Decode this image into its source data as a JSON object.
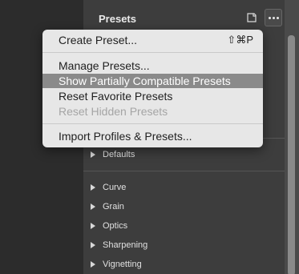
{
  "panel": {
    "title": "Presets"
  },
  "icons": {
    "new_preset": "new-preset-icon",
    "more": "more-options-icon"
  },
  "menu": {
    "items": [
      {
        "label": "Create Preset...",
        "shortcut": "⇧⌘P",
        "enabled": true
      },
      {
        "label": "Manage Presets...",
        "enabled": true
      },
      {
        "label": "Show Partially Compatible Presets",
        "enabled": true,
        "highlighted": true
      },
      {
        "label": "Reset Favorite Presets",
        "enabled": true
      },
      {
        "label": "Reset Hidden Presets",
        "enabled": false
      },
      {
        "label": "Import Profiles & Presets...",
        "enabled": true
      }
    ]
  },
  "groups": [
    {
      "label": "Defaults"
    },
    {
      "label": "Curve"
    },
    {
      "label": "Grain"
    },
    {
      "label": "Optics"
    },
    {
      "label": "Sharpening"
    },
    {
      "label": "Vignetting"
    }
  ],
  "colors": {
    "panel_bg": "#3d3d3d",
    "menu_bg": "#e7e7e7",
    "menu_highlight": "#8a8a8a"
  }
}
